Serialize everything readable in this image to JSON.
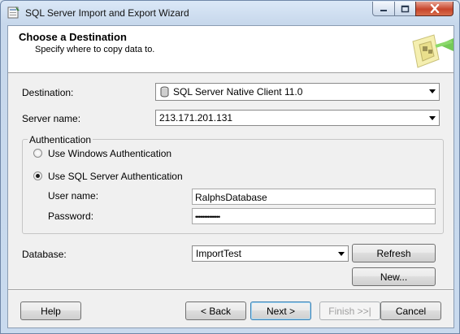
{
  "window": {
    "title": "SQL Server Import and Export Wizard"
  },
  "header": {
    "title": "Choose a Destination",
    "subtitle": "Specify where to copy data to."
  },
  "form": {
    "destination_label": "Destination:",
    "destination_value": "SQL Server Native Client 11.0",
    "server_label": "Server name:",
    "server_value": "213.171.201.131",
    "auth_group_label": "Authentication",
    "auth_windows_label": "Use Windows Authentication",
    "auth_sql_label": "Use SQL Server Authentication",
    "auth_selected": "sql",
    "username_label": "User name:",
    "username_value": "RalphsDatabase",
    "password_label": "Password:",
    "password_mask": "••••••••••••••",
    "database_label": "Database:",
    "database_value": "ImportTest"
  },
  "buttons": {
    "refresh": "Refresh",
    "new": "New...",
    "help": "Help",
    "back": "< Back",
    "next": "Next >",
    "finish": "Finish >>|",
    "cancel": "Cancel"
  },
  "icons": {
    "app": "wizard-app-icon",
    "destination": "database-cylinder-icon",
    "header": "database-arrow-art"
  }
}
